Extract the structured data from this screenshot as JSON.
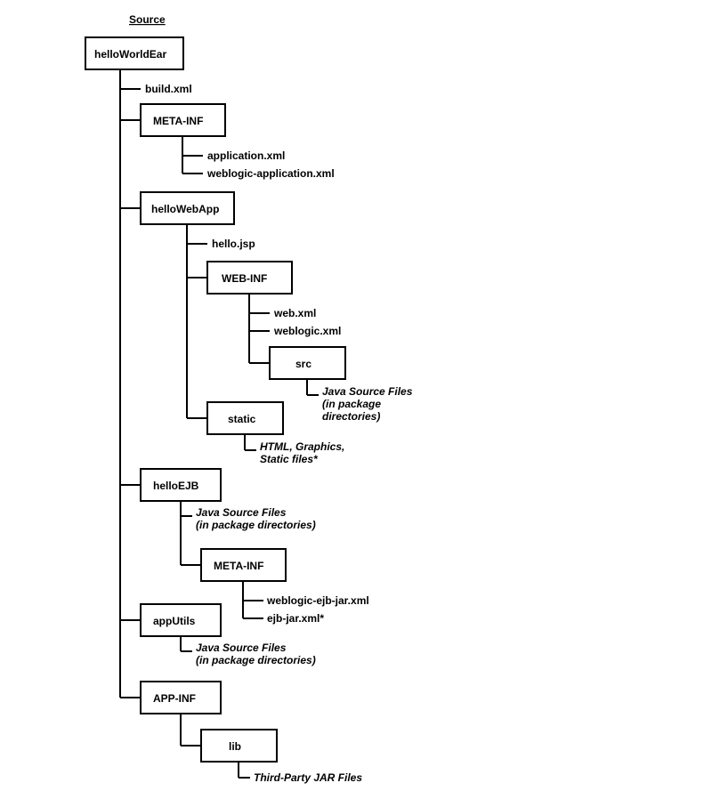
{
  "title": "Source",
  "root": {
    "label": "helloWorldEar"
  },
  "build_xml": "build.xml",
  "meta_inf": {
    "label": "META-INF",
    "files": [
      "application.xml",
      "weblogic-application.xml"
    ]
  },
  "hello_web_app": {
    "label": "helloWebApp",
    "hello_jsp": "hello.jsp",
    "web_inf": {
      "label": "WEB-INF",
      "files": [
        "web.xml",
        "weblogic.xml"
      ],
      "src": {
        "label": "src",
        "note_l1": "Java Source Files",
        "note_l2": "(in package",
        "note_l3": "directories)"
      }
    },
    "static": {
      "label": "static",
      "note_l1": "HTML, Graphics,",
      "note_l2": "Static files*"
    }
  },
  "hello_ejb": {
    "label": "helloEJB",
    "note_l1": "Java Source Files",
    "note_l2": "(in package directories)",
    "meta_inf": {
      "label": "META-INF",
      "files": [
        "weblogic-ejb-jar.xml",
        "ejb-jar.xml*"
      ]
    }
  },
  "app_utils": {
    "label": "appUtils",
    "note_l1": "Java Source Files",
    "note_l2": "(in package directories)"
  },
  "app_inf": {
    "label": "APP-INF",
    "lib": {
      "label": "lib",
      "note": "Third-Party JAR Files"
    }
  }
}
